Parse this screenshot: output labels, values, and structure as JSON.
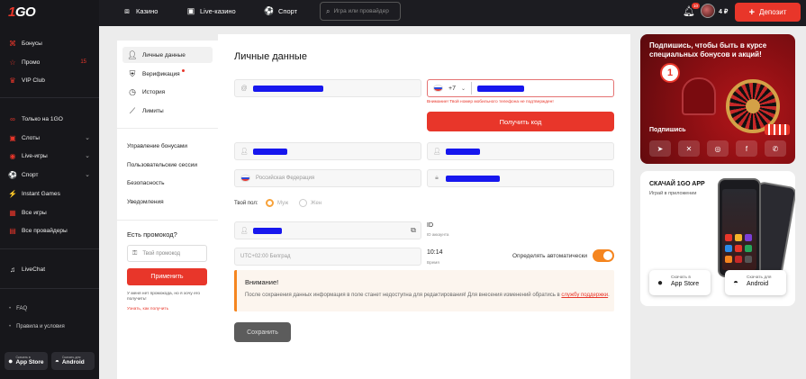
{
  "brand": {
    "logo_left": "1",
    "logo_right": "GO"
  },
  "topbar": {
    "nav": [
      {
        "label": "Казино",
        "icon": "casino-icon"
      },
      {
        "label": "Live-казино",
        "icon": "live-icon"
      },
      {
        "label": "Спорт",
        "icon": "soccer-ball-icon"
      }
    ],
    "search_placeholder": "Игра или провайдер",
    "notification_count": "10",
    "balance": "4 ₽",
    "deposit_label": "Депозит"
  },
  "sidebar": {
    "group1": [
      {
        "label": "Бонусы",
        "icon": "gift-icon"
      },
      {
        "label": "Промо",
        "icon": "star-icon",
        "count": "15"
      },
      {
        "label": "VIP Club",
        "icon": "crown-icon"
      }
    ],
    "group2": [
      {
        "label": "Только на 1GO",
        "icon": "infinity-icon"
      },
      {
        "label": "Слоты",
        "icon": "slots-icon",
        "chevron": true
      },
      {
        "label": "Live-игры",
        "icon": "live-games-icon",
        "chevron": true
      },
      {
        "label": "Спорт",
        "icon": "sport-icon",
        "chevron": true
      },
      {
        "label": "Instant Games",
        "icon": "lightning-icon"
      },
      {
        "label": "Все игры",
        "icon": "grid-icon"
      },
      {
        "label": "Все провайдеры",
        "icon": "providers-icon"
      }
    ],
    "livechat": "LiveChat",
    "footer": [
      {
        "label": "FAQ"
      },
      {
        "label": "Правила и условия"
      }
    ],
    "stores": [
      {
        "small": "Скачать в",
        "big": "App Store"
      },
      {
        "small": "Скачать для",
        "big": "Android"
      }
    ]
  },
  "profile_menu": {
    "items": [
      {
        "label": "Личные данные",
        "icon": "user-icon",
        "active": true
      },
      {
        "label": "Верификация",
        "icon": "shield-icon",
        "dot": true
      },
      {
        "label": "История",
        "icon": "clock-icon"
      },
      {
        "label": "Лимиты",
        "icon": "ruler-icon"
      }
    ],
    "links": [
      "Управление бонусами",
      "Пользовательские сессии",
      "Безопасность",
      "Уведомления"
    ],
    "promo": {
      "title": "Есть промокод?",
      "placeholder": "Твой промокод",
      "apply": "Применить",
      "note": "У меня нет промокода, но я хочу его получить!",
      "link": "Узнать, как получить"
    }
  },
  "form": {
    "title": "Личные данные",
    "phone_code": "+7",
    "phone_warning": "Внимание! Твой номер мобильного телефона не подтвержден!",
    "get_code": "Получить код",
    "country": "Российская Федерация",
    "gender_label": "Твой пол:",
    "gender_options": [
      "Муж",
      "Жен"
    ],
    "id_label": "ID",
    "id_sub": "ID аккаунта",
    "timezone": "UTC+02:00 Белград",
    "time": "10:14",
    "time_sub": "Время",
    "auto_label": "Определять автоматически",
    "attention_title": "Внимание!",
    "attention_text": "После сохранения данных информация в поле станет недоступна для редактирования! Для внесения изменений обратись в ",
    "attention_link": "службу поддержки",
    "attention_end": ".",
    "save": "Сохранить"
  },
  "banners": {
    "subscribe": {
      "title": "Подпишись, чтобы быть в курсе специальных бонусов и акций!",
      "badge": "1",
      "label": "Подпишись",
      "socials": [
        "telegram-icon",
        "x-icon",
        "instagram-icon",
        "facebook-icon",
        "whatsapp-icon"
      ]
    },
    "app": {
      "title": "СКАЧАЙ 1GO APP",
      "subtitle": "Играй в приложении",
      "ios_small": "Скачать в",
      "ios_big": "App Store",
      "android_small": "Скачать для",
      "android_big": "Android"
    }
  },
  "colors": {
    "accent": "#e8362a",
    "toggle": "#f5851f",
    "redaction": "#1717ee"
  }
}
